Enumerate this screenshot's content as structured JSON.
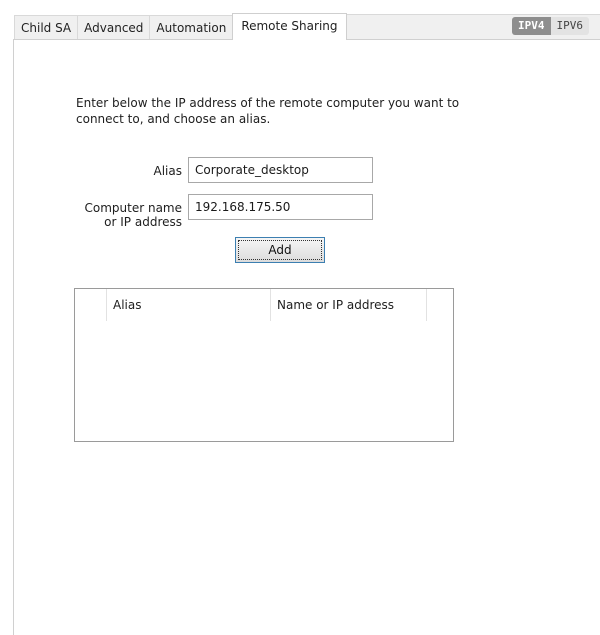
{
  "tabs": [
    {
      "label": "Child SA",
      "active": false
    },
    {
      "label": "Advanced",
      "active": false
    },
    {
      "label": "Automation",
      "active": false
    },
    {
      "label": "Remote Sharing",
      "active": true
    }
  ],
  "ip_version": {
    "options": [
      "IPV4",
      "IPV6"
    ],
    "selected": "IPV4"
  },
  "instructions": "Enter below the IP address of the remote computer you want to connect to, and choose an alias.",
  "form": {
    "alias_label": "Alias",
    "alias_value": "Corporate_desktop",
    "address_label_line1": "Computer name",
    "address_label_line2": "or IP address",
    "address_value": "192.168.175.50",
    "add_button": "Add"
  },
  "list": {
    "columns": [
      "Alias",
      "Name or IP address"
    ],
    "rows": []
  }
}
